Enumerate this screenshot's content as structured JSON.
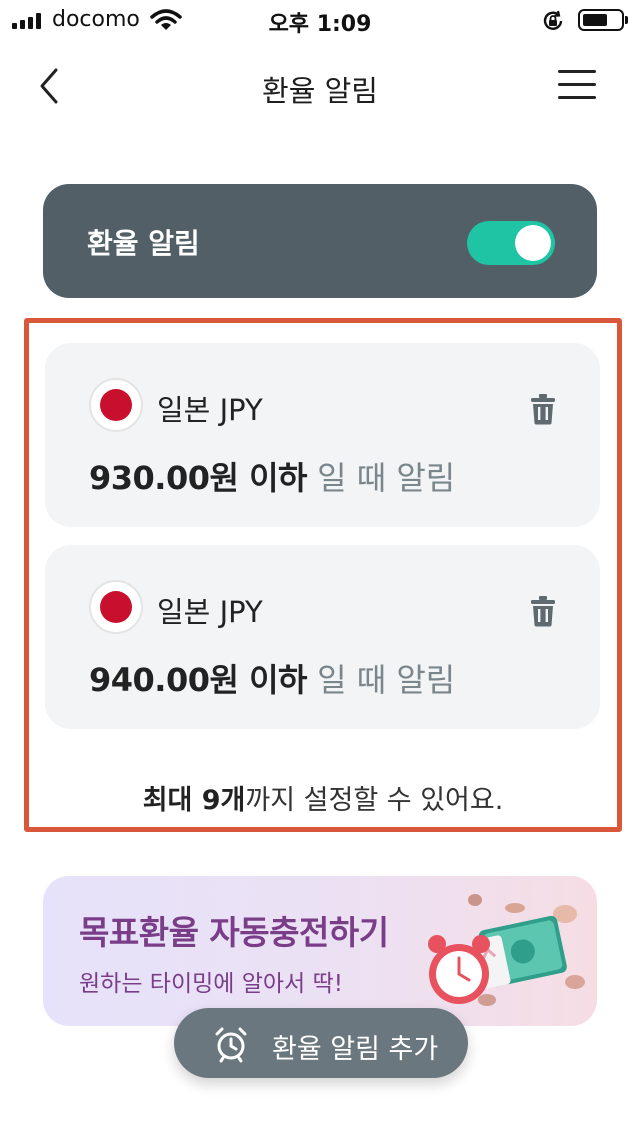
{
  "status_bar": {
    "carrier": "docomo",
    "time": "오후 1:09",
    "icons": [
      "signal-icon",
      "wifi-icon",
      "orientation-lock-icon",
      "battery-icon"
    ]
  },
  "nav": {
    "title": "환율 알림",
    "back_icon": "chevron-left-icon",
    "menu_icon": "hamburger-menu-icon"
  },
  "toggle_card": {
    "label": "환율 알림",
    "enabled": true,
    "switch_color": "#1fc4a4",
    "card_color": "#525f67"
  },
  "alerts": [
    {
      "flag": "japan-flag-icon",
      "currency": "일본 JPY",
      "threshold": "930.00원 이하",
      "suffix": " 일 때 알림"
    },
    {
      "flag": "japan-flag-icon",
      "currency": "일본 JPY",
      "threshold": "940.00원 이하",
      "suffix": " 일 때 알림"
    }
  ],
  "max_note": {
    "strong": "최대 9개",
    "rest": "까지 설정할 수 있어요."
  },
  "promo": {
    "title": "목표환율 자동충전하기",
    "subtitle": "원하는 타이밍에 알아서 딱!",
    "art_icons": [
      "alarm-clock-icon",
      "money-stack-icon",
      "coin-icon"
    ],
    "text_color": "#7a3d88"
  },
  "fab": {
    "label": "환율 알림 추가",
    "icon": "alarm-clock-icon"
  },
  "colors": {
    "highlight_border": "#d9573a",
    "alert_card_bg": "#f2f4f5",
    "muted_text": "#7b858c"
  }
}
